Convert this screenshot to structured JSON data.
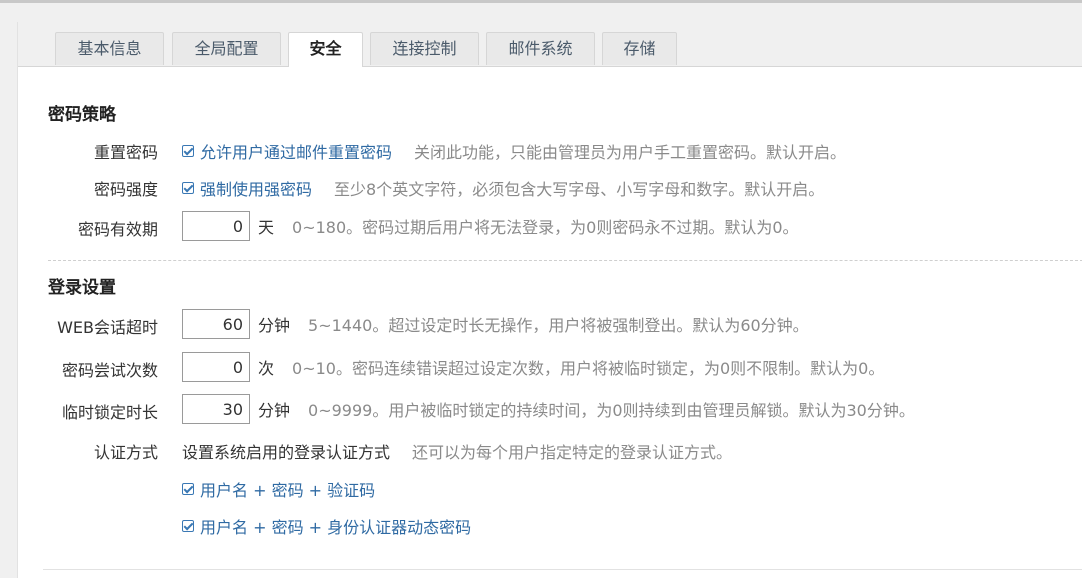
{
  "tabs": [
    {
      "label": "基本信息"
    },
    {
      "label": "全局配置"
    },
    {
      "label": "安全"
    },
    {
      "label": "连接控制"
    },
    {
      "label": "邮件系统"
    },
    {
      "label": "存储"
    }
  ],
  "active_tab": "安全",
  "password_policy": {
    "title": "密码策略",
    "reset": {
      "label": "重置密码",
      "checkbox_label": "允许用户通过邮件重置密码",
      "checked": true,
      "help": "关闭此功能，只能由管理员为用户手工重置密码。默认开启。"
    },
    "strength": {
      "label": "密码强度",
      "checkbox_label": "强制使用强密码",
      "checked": true,
      "help": "至少8个英文字符，必须包含大写字母、小写字母和数字。默认开启。"
    },
    "expiry": {
      "label": "密码有效期",
      "value": "0",
      "unit": "天",
      "help": "0~180。密码过期后用户将无法登录，为0则密码永不过期。默认为0。"
    }
  },
  "login_settings": {
    "title": "登录设置",
    "session_timeout": {
      "label": "WEB会话超时",
      "value": "60",
      "unit": "分钟",
      "help": "5~1440。超过设定时长无操作，用户将被强制登出。默认为60分钟。"
    },
    "attempts": {
      "label": "密码尝试次数",
      "value": "0",
      "unit": "次",
      "help": "0~10。密码连续错误超过设定次数，用户将被临时锁定，为0则不限制。默认为0。"
    },
    "lock_duration": {
      "label": "临时锁定时长",
      "value": "30",
      "unit": "分钟",
      "help": "0~9999。用户被临时锁定的持续时间，为0则持续到由管理员解锁。默认为30分钟。"
    },
    "auth": {
      "label": "认证方式",
      "description": "设置系统启用的登录认证方式",
      "help": "还可以为每个用户指定特定的登录认证方式。",
      "options": [
        {
          "label": "用户名 + 密码 + 验证码",
          "checked": true
        },
        {
          "label": "用户名 + 密码 + 身份认证器动态密码",
          "checked": true
        }
      ]
    }
  }
}
